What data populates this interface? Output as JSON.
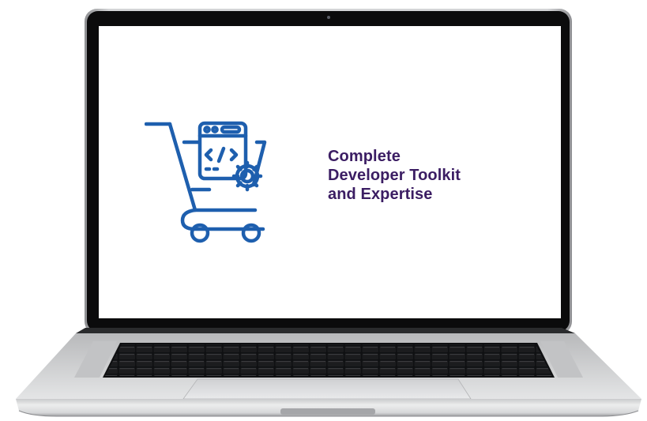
{
  "colors": {
    "icon_blue": "#1e5fae",
    "text_purple": "#3b1d63",
    "bezel": "#0b0b0c",
    "body_silver": "#d9dadc"
  },
  "screen": {
    "headline_lines": [
      "Complete",
      "Developer Toolkit",
      "and Expertise"
    ],
    "icon": "shopping-cart-code-gear-icon"
  }
}
